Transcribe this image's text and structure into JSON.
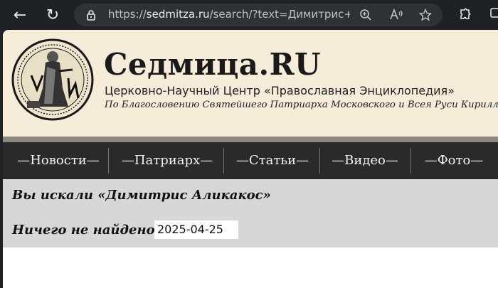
{
  "browser": {
    "url_scheme": "https://",
    "url_host": "sedmitza.ru",
    "url_path": "/search/?text=Димитрис+Алик..."
  },
  "site": {
    "title": "Седмица.RU",
    "subtitle": "Церковно-Научный Центр «Православная Энциклопедия»",
    "blessing": "По Благословению Святейшего Патриарха Московского и Всея Руси Кирилла"
  },
  "nav": {
    "items": [
      {
        "label": "—Новости—"
      },
      {
        "label": "—Патриарх—"
      },
      {
        "label": "—Статьи—"
      },
      {
        "label": "—Видео—"
      },
      {
        "label": "—Фото—"
      }
    ]
  },
  "search": {
    "heading": "Вы искали «Димитрис Аликакос»",
    "no_results": "Ничего не найдено",
    "date": "2025-04-25"
  },
  "colors": {
    "header_bg": "#f5ecd9",
    "nav_bg": "#2a2a2a",
    "results_bg": "#d7d7d7"
  }
}
